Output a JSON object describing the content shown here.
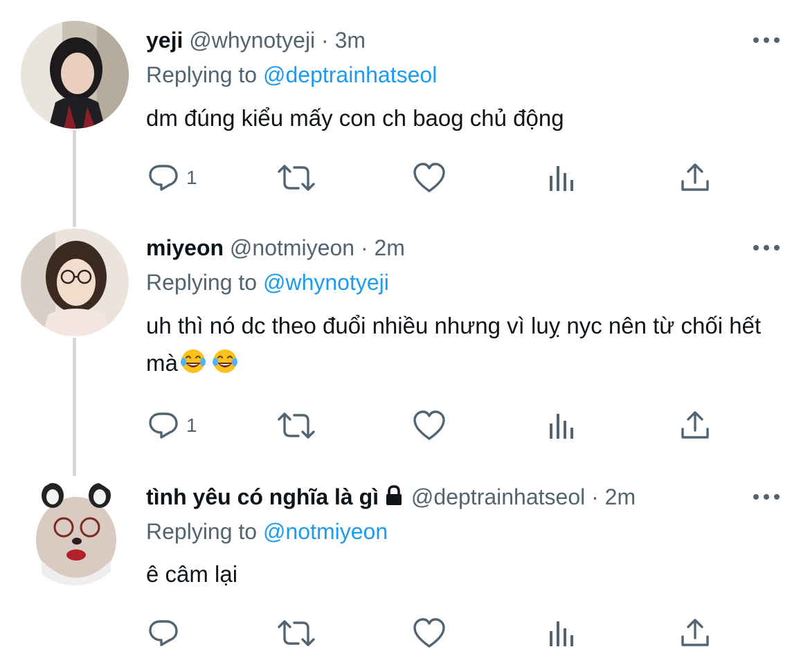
{
  "tweets": [
    {
      "name": "yeji",
      "handle": "@whynotyeji",
      "separator": "·",
      "time": "3m",
      "replying_prefix": "Replying to",
      "replying_to": "@deptrainhatseol",
      "text": "dm đúng kiểu mấy con ch baog chủ động",
      "reply_count": "1",
      "locked": false
    },
    {
      "name": "miyeon",
      "handle": "@notmiyeon",
      "separator": "·",
      "time": "2m",
      "replying_prefix": "Replying to",
      "replying_to": "@whynotyeji",
      "text": "uh thì nó dc theo đuổi nhiều nhưng vì luỵ nyc nên từ chối hết mà",
      "emoji": [
        "face-with-tears-of-joy",
        "face-with-tears-of-joy"
      ],
      "reply_count": "1",
      "locked": false
    },
    {
      "name": "tình yêu có nghĩa là gì",
      "handle": "@deptrainhatseol",
      "separator": "·",
      "time": "2m",
      "replying_prefix": "Replying to",
      "replying_to": "@notmiyeon",
      "text": "ê câm lại",
      "reply_count": "",
      "locked": true
    }
  ],
  "icons": [
    "more-icon",
    "reply-icon",
    "retweet-icon",
    "like-icon",
    "analytics-icon",
    "share-icon",
    "lock-icon"
  ],
  "colors": {
    "text": "#0f1419",
    "secondary": "#536471",
    "link": "#1d9bf0",
    "thread_line": "#cfd9de"
  }
}
